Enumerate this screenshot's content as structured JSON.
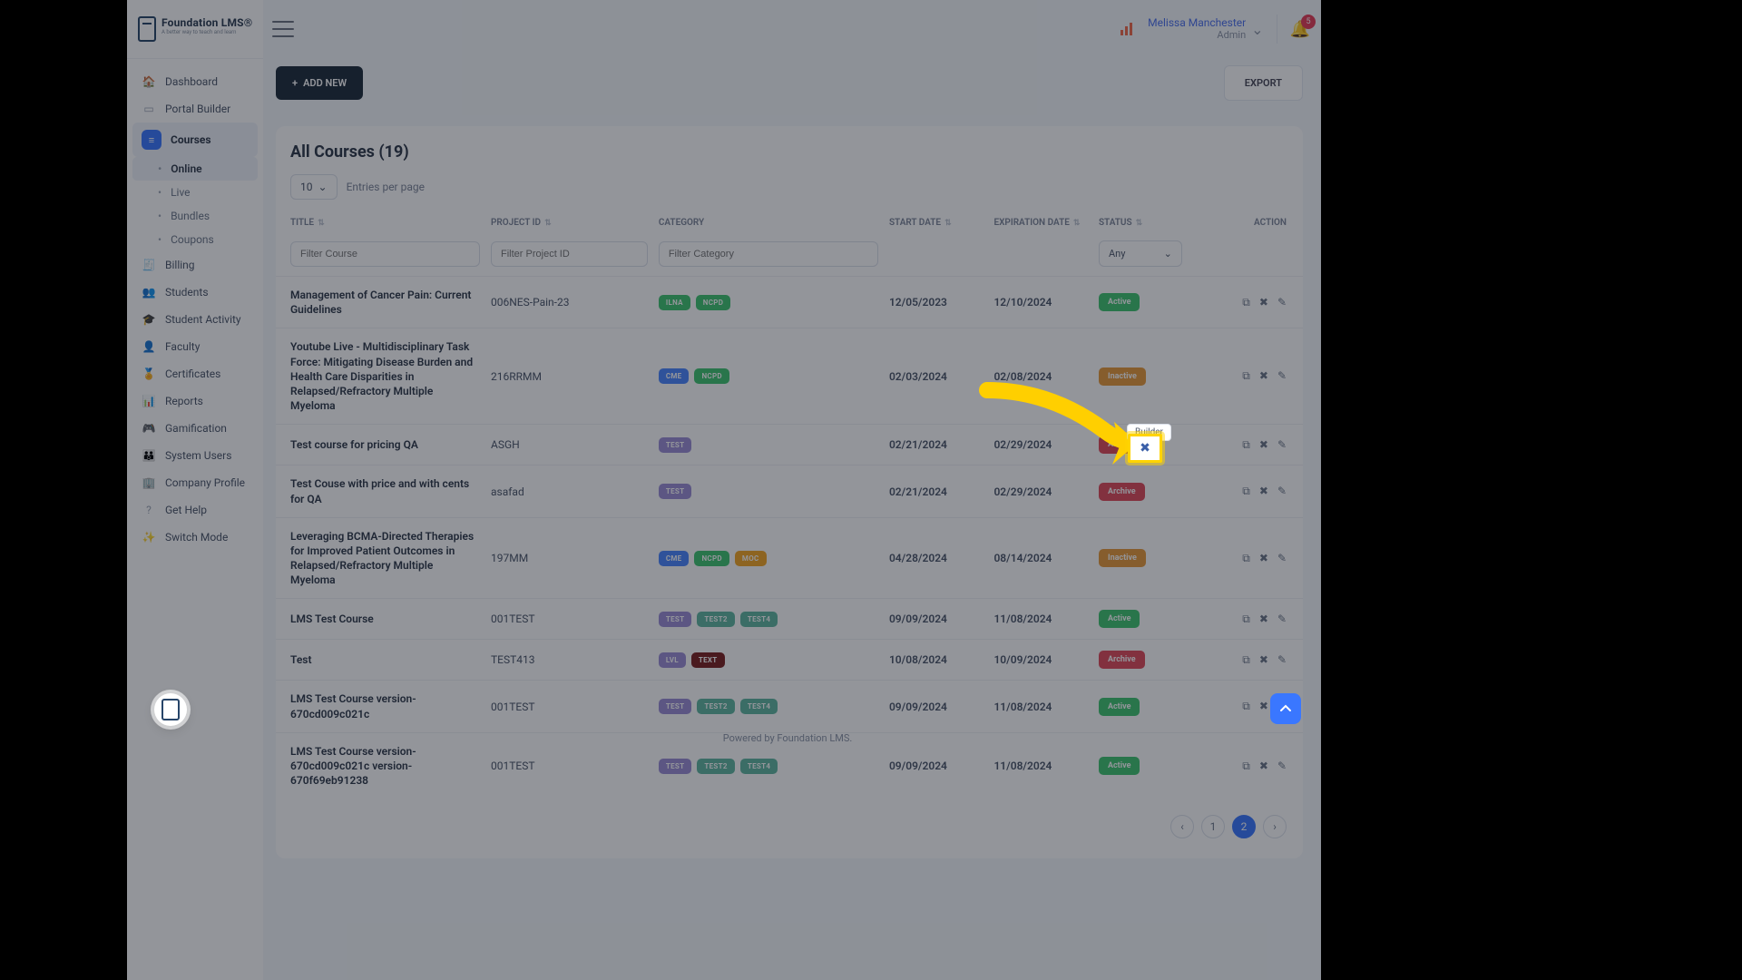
{
  "brand": {
    "title": "Foundation LMS®",
    "subtitle": "A better way to teach and learn"
  },
  "header": {
    "user_name": "Melissa Manchester",
    "user_role": "Admin",
    "notif_count": "5"
  },
  "sidebar": {
    "items": [
      {
        "label": "Dashboard",
        "icon": "🏠"
      },
      {
        "label": "Portal Builder",
        "icon": "▭"
      },
      {
        "label": "Courses",
        "icon": "≡"
      },
      {
        "label": "Billing",
        "icon": "🧾"
      },
      {
        "label": "Students",
        "icon": "👥"
      },
      {
        "label": "Student Activity",
        "icon": "🎓"
      },
      {
        "label": "Faculty",
        "icon": "👤"
      },
      {
        "label": "Certificates",
        "icon": "🏅"
      },
      {
        "label": "Reports",
        "icon": "📊"
      },
      {
        "label": "Gamification",
        "icon": "🎮"
      },
      {
        "label": "System Users",
        "icon": "👪"
      },
      {
        "label": "Company Profile",
        "icon": "🏢"
      },
      {
        "label": "Get Help",
        "icon": "?"
      },
      {
        "label": "Switch Mode",
        "icon": "✨"
      }
    ],
    "course_sub": [
      {
        "label": "Online"
      },
      {
        "label": "Live"
      },
      {
        "label": "Bundles"
      },
      {
        "label": "Coupons"
      }
    ]
  },
  "buttons": {
    "add_new": "ADD NEW",
    "export": "EXPORT"
  },
  "page_title": "All Courses (19)",
  "per_page": {
    "value": "10",
    "label": "Entries per page"
  },
  "columns": {
    "title": "TITLE",
    "project_id": "PROJECT ID",
    "category": "CATEGORY",
    "start_date": "START DATE",
    "expiration": "EXPIRATION DATE",
    "status": "STATUS",
    "action": "ACTION"
  },
  "filters": {
    "course_ph": "Filter Course",
    "project_ph": "Filter Project ID",
    "category_ph": "Filter Category",
    "status_any": "Any"
  },
  "tooltip": {
    "builder": "Builder"
  },
  "pager": {
    "prev": "‹",
    "p1": "1",
    "p2": "2",
    "next": "›"
  },
  "footer": "Powered by Foundation LMS.",
  "rows": [
    {
      "title": "Management of Cancer Pain: Current Guidelines",
      "pid": "006NES-Pain-23",
      "cats": [
        {
          "t": "ILNA",
          "c": "p-green"
        },
        {
          "t": "NCPD",
          "c": "p-green"
        }
      ],
      "start": "12/05/2023",
      "exp": "12/10/2024",
      "status": {
        "t": "Active",
        "c": "s-active"
      }
    },
    {
      "title": "Youtube Live - Multidisciplinary Task Force: Mitigating Disease Burden and Health Care Disparities in Relapsed/Refractory Multiple Myeloma",
      "pid": "216RRMM",
      "cats": [
        {
          "t": "CME",
          "c": "p-blue"
        },
        {
          "t": "NCPD",
          "c": "p-green"
        }
      ],
      "start": "02/03/2024",
      "exp": "02/08/2024",
      "status": {
        "t": "Inactive",
        "c": "s-inactive"
      }
    },
    {
      "title": "Test course for pricing QA",
      "pid": "ASGH",
      "cats": [
        {
          "t": "TEST",
          "c": "p-purple"
        }
      ],
      "start": "02/21/2024",
      "exp": "02/29/2024",
      "status": {
        "t": "Archive",
        "c": "s-archive"
      }
    },
    {
      "title": "Test Couse with price and with cents for QA",
      "pid": "asafad",
      "cats": [
        {
          "t": "TEST",
          "c": "p-purple"
        }
      ],
      "start": "02/21/2024",
      "exp": "02/29/2024",
      "status": {
        "t": "Archive",
        "c": "s-archive"
      }
    },
    {
      "title": "Leveraging BCMA-Directed Therapies for Improved Patient Outcomes in Relapsed/Refractory Multiple Myeloma",
      "pid": "197MM",
      "cats": [
        {
          "t": "CME",
          "c": "p-blue"
        },
        {
          "t": "NCPD",
          "c": "p-green"
        },
        {
          "t": "MOC",
          "c": "p-orange"
        }
      ],
      "start": "04/28/2024",
      "exp": "08/14/2024",
      "status": {
        "t": "Inactive",
        "c": "s-inactive"
      }
    },
    {
      "title": "LMS Test Course",
      "pid": "001TEST",
      "cats": [
        {
          "t": "TEST",
          "c": "p-purple"
        },
        {
          "t": "TEST2",
          "c": "p-teal"
        },
        {
          "t": "TEST4",
          "c": "p-teal"
        }
      ],
      "start": "09/09/2024",
      "exp": "11/08/2024",
      "status": {
        "t": "Active",
        "c": "s-active"
      }
    },
    {
      "title": "Test",
      "pid": "TEST413",
      "cats": [
        {
          "t": "LVL",
          "c": "p-purple"
        },
        {
          "t": "TEXT",
          "c": "p-dred"
        }
      ],
      "start": "10/08/2024",
      "exp": "10/09/2024",
      "status": {
        "t": "Archive",
        "c": "s-archive"
      }
    },
    {
      "title": "LMS Test Course version-670cd009c021c",
      "pid": "001TEST",
      "cats": [
        {
          "t": "TEST",
          "c": "p-purple"
        },
        {
          "t": "TEST2",
          "c": "p-teal"
        },
        {
          "t": "TEST4",
          "c": "p-teal"
        }
      ],
      "start": "09/09/2024",
      "exp": "11/08/2024",
      "status": {
        "t": "Active",
        "c": "s-active"
      }
    },
    {
      "title": "LMS Test Course version-670cd009c021c version-670f69eb91238",
      "pid": "001TEST",
      "cats": [
        {
          "t": "TEST",
          "c": "p-purple"
        },
        {
          "t": "TEST2",
          "c": "p-teal"
        },
        {
          "t": "TEST4",
          "c": "p-teal"
        }
      ],
      "start": "09/09/2024",
      "exp": "11/08/2024",
      "status": {
        "t": "Active",
        "c": "s-active"
      }
    }
  ]
}
